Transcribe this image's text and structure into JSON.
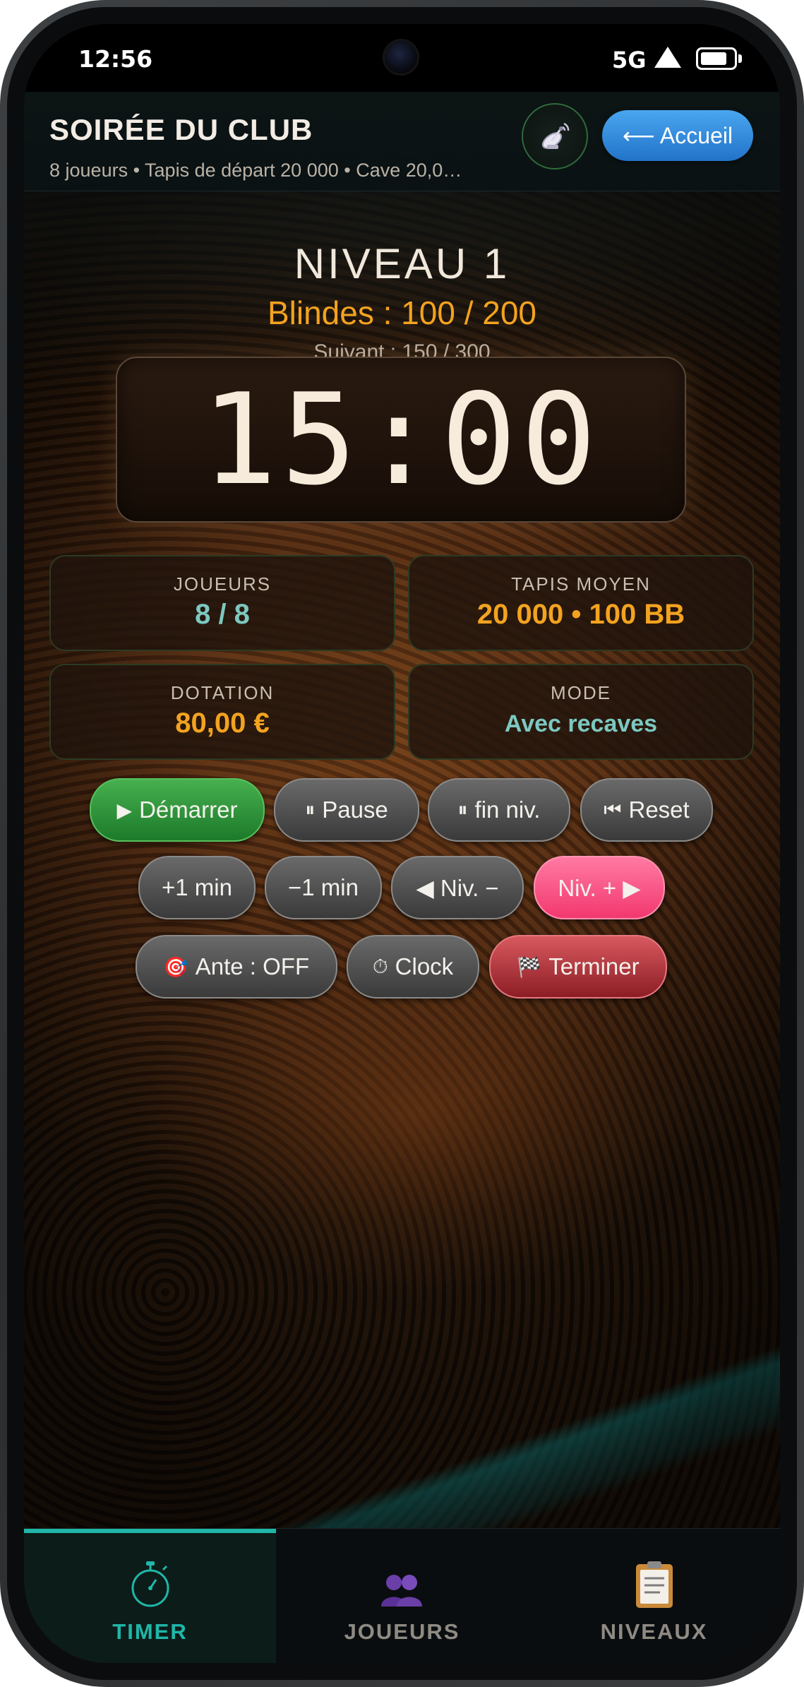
{
  "status_bar": {
    "time": "12:56",
    "network": "5G"
  },
  "header": {
    "title": "SOIRÉE DU CLUB",
    "subtitle": "8 joueurs • Tapis de départ 20 000 • Cave 20,0…",
    "home_label": "⟵ Accueil",
    "cast_icon": "satellite-icon"
  },
  "level": {
    "title": "NIVEAU 1",
    "blinds": "Blindes : 100 / 200",
    "next": "Suivant : 150 / 300"
  },
  "timer": {
    "display": "15:00"
  },
  "stats": [
    {
      "label": "JOUEURS",
      "value": "8 / 8"
    },
    {
      "label": "TAPIS MOYEN",
      "value": "20 000 • 100 BB"
    },
    {
      "label": "DOTATION",
      "value": "80,00 €"
    },
    {
      "label": "MODE",
      "value": "Avec recaves"
    }
  ],
  "controls": {
    "start": {
      "icon": "▶",
      "label": "Démarrer"
    },
    "pause": {
      "icon": "⏸",
      "label": "Pause"
    },
    "pause_end": {
      "icon": "⏸",
      "label": "fin niv."
    },
    "reset": {
      "icon": "⏮",
      "label": "Reset"
    },
    "plus_min": "+1 min",
    "minus_min": "−1 min",
    "level_down": "◀ Niv. −",
    "level_up": "Niv. + ▶",
    "ante": {
      "icon": "🎯",
      "label": "Ante : OFF"
    },
    "clock": {
      "icon": "⏱",
      "label": "Clock"
    },
    "finish": {
      "icon": "🏁",
      "label": "Terminer"
    }
  },
  "nav": [
    {
      "label": "TIMER",
      "icon": "stopwatch-icon",
      "active": true
    },
    {
      "label": "JOUEURS",
      "icon": "players-icon",
      "active": false
    },
    {
      "label": "NIVEAUX",
      "icon": "clipboard-icon",
      "active": false
    }
  ],
  "colors": {
    "accent_orange": "#f3a31f",
    "accent_teal": "#7cc8c0",
    "active_tab": "#1fb7a8",
    "home_button": "#2f8ade"
  }
}
